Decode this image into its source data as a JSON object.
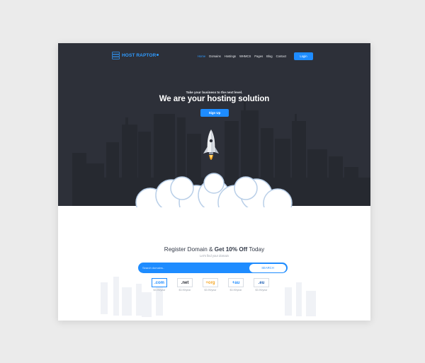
{
  "brand": {
    "name": "HOST RAPTOR"
  },
  "nav": {
    "items": [
      {
        "label": "Home",
        "active": true
      },
      {
        "label": "Domains",
        "active": false
      },
      {
        "label": "Hostings",
        "active": false
      },
      {
        "label": "WHMCS",
        "active": false
      },
      {
        "label": "Pages",
        "active": false
      },
      {
        "label": "Blog",
        "active": false
      },
      {
        "label": "Contact",
        "active": false
      }
    ],
    "login_label": "Login"
  },
  "hero": {
    "tagline": "Take your business to the next level.",
    "headline": "We are your hosting solution",
    "cta_label": "Sign Up"
  },
  "domain": {
    "title_plain": "Register Domain & ",
    "title_bold": "Get 10% Off",
    "title_end": " Today",
    "subtitle": "Let's find your domain",
    "search_placeholder": "Search domains..",
    "search_button": "SEARCH",
    "tlds": [
      {
        "name": ".com",
        "price": "$3.99/year",
        "color": "#1e8cff"
      },
      {
        "name": ".net",
        "price": "$3.99/year",
        "color": "#2d3039"
      },
      {
        "name": "+org",
        "price": "$3.99/year",
        "color": "#f5a623"
      },
      {
        "name": "+au",
        "price": "$3.99/year",
        "color": "#1e8cff"
      },
      {
        "name": ".eu",
        "price": "$3.99/year",
        "color": "#1e5fb4"
      }
    ]
  },
  "colors": {
    "hero_bg": "#2d3039",
    "accent": "#1e8cff",
    "skyline": "#272a32"
  }
}
